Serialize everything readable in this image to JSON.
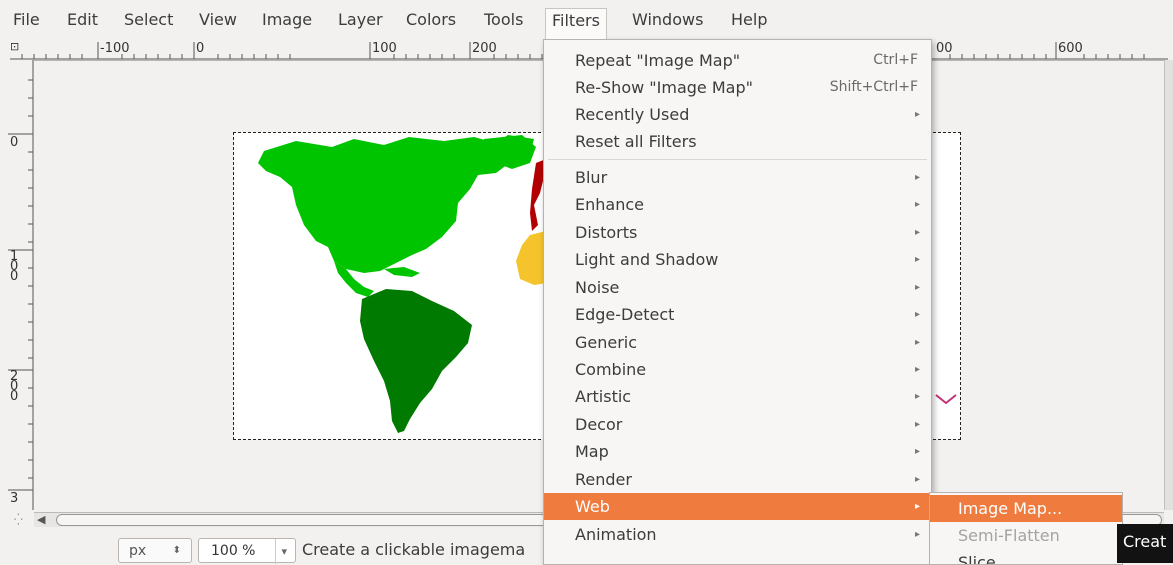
{
  "menubar": {
    "items": [
      {
        "label": "File"
      },
      {
        "label": "Edit"
      },
      {
        "label": "Select"
      },
      {
        "label": "View"
      },
      {
        "label": "Image"
      },
      {
        "label": "Layer"
      },
      {
        "label": "Colors"
      },
      {
        "label": "Tools"
      },
      {
        "label": "Filters"
      },
      {
        "label": "Windows"
      },
      {
        "label": "Help"
      }
    ]
  },
  "ruler": {
    "h_labels": [
      "-100",
      "0",
      "100",
      "200",
      "600"
    ],
    "h_partial": "00",
    "v_labels": [
      "0",
      "1 0 0",
      "2 0 0",
      "3"
    ]
  },
  "filters_menu": {
    "items": [
      {
        "label": "Repeat \"Image Map\"",
        "accel": "Ctrl+F"
      },
      {
        "label": "Re-Show \"Image Map\"",
        "accel": "Shift+Ctrl+F"
      },
      {
        "label": "Recently Used"
      },
      {
        "label": "Reset all Filters"
      },
      {
        "label": "Blur"
      },
      {
        "label": "Enhance"
      },
      {
        "label": "Distorts"
      },
      {
        "label": "Light and Shadow"
      },
      {
        "label": "Noise"
      },
      {
        "label": "Edge-Detect"
      },
      {
        "label": "Generic"
      },
      {
        "label": "Combine"
      },
      {
        "label": "Artistic"
      },
      {
        "label": "Decor"
      },
      {
        "label": "Map"
      },
      {
        "label": "Render"
      },
      {
        "label": "Web"
      },
      {
        "label": "Animation"
      }
    ],
    "highlighted": "Web"
  },
  "web_submenu": {
    "items": [
      {
        "label": "Image Map...",
        "state": "highlighted"
      },
      {
        "label": "Semi-Flatten",
        "state": "disabled"
      },
      {
        "label": "Slice",
        "state": "normal"
      }
    ]
  },
  "tooltip": {
    "text": "Creat"
  },
  "statusbar": {
    "unit": "px",
    "zoom": "100 %",
    "message": "Create a clickable imagema"
  },
  "colors": {
    "accent": "#ef7b3e",
    "north_america": "#00c400",
    "south_america": "#007a00",
    "africa": "#f5c42c",
    "europe": "#b30000"
  }
}
